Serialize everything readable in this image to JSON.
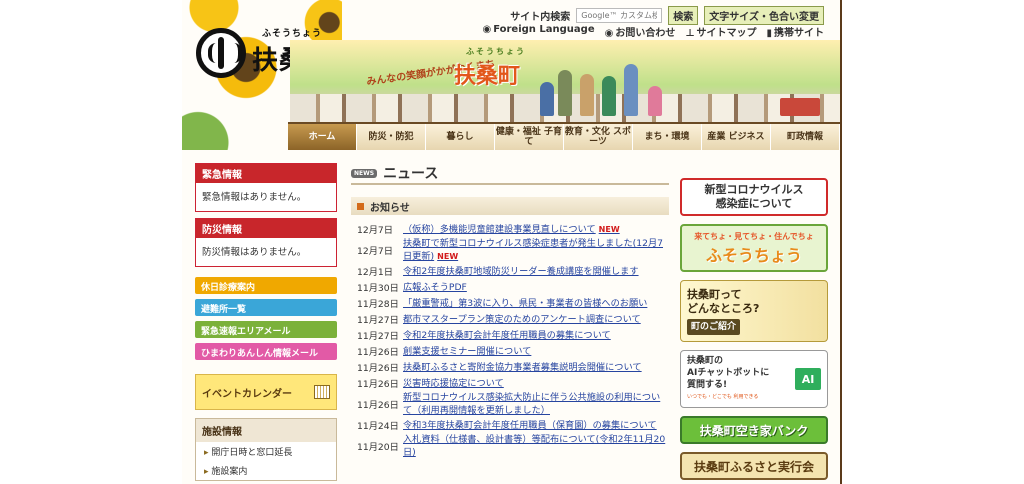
{
  "header": {
    "logo_ruby": "ふそうちょう",
    "logo_name": "扶桑町",
    "search_label": "サイト内検索",
    "search_placeholder": "Google™ カスタム検索",
    "search_button": "検索",
    "display_button": "文字サイズ・色合い変更",
    "util_links": [
      "Foreign Language",
      "お問い合わせ",
      "サイトマップ",
      "携帯サイト"
    ],
    "banner_tagline": "みんなの笑顔がかがやくまち",
    "banner_ruby": "ふそうちょう",
    "banner_title": "扶桑町"
  },
  "nav": [
    {
      "label": "ホーム",
      "active": true
    },
    {
      "label": "防災・防犯"
    },
    {
      "label": "暮らし"
    },
    {
      "label": "健康・福祉 子育て"
    },
    {
      "label": "教育・文化 スポーツ"
    },
    {
      "label": "まち・環境"
    },
    {
      "label": "産業 ビジネス"
    },
    {
      "label": "町政情報"
    }
  ],
  "left": {
    "emergency_title": "緊急情報",
    "emergency_text": "緊急情報はありません。",
    "disaster_title": "防災情報",
    "disaster_text": "防災情報はありません。",
    "buttons": [
      {
        "label": "休日診療案内",
        "color": "#f0a800"
      },
      {
        "label": "避難所一覧",
        "color": "#3aa6d8"
      },
      {
        "label": "緊急速報エリアメール",
        "color": "#7bb13a"
      },
      {
        "label": "ひまわりあんしん情報メール",
        "color": "#e25aa6"
      }
    ],
    "event_calendar": "イベントカレンダー",
    "facility_title": "施設情報",
    "facility_items": [
      "開庁日時と窓口延長",
      "施設案内"
    ]
  },
  "news": {
    "icon_text": "NEWS",
    "title": "ニュース",
    "notice_title": "お知らせ",
    "items": [
      {
        "date": "12月7日",
        "text": "（仮称）多機能児童館建設事業見直しについて",
        "new": "NEW"
      },
      {
        "date": "12月7日",
        "text": "扶桑町で新型コロナウイルス感染症患者が発生しました(12月7日更新)",
        "new": "NEW"
      },
      {
        "date": "12月1日",
        "text": "令和2年度扶桑町地域防災リーダー養成講座を開催します",
        "new": ""
      },
      {
        "date": "11月30日",
        "text": "広報ふそうPDF",
        "new": ""
      },
      {
        "date": "11月28日",
        "text": "「厳重警戒」第3波に入り、県民・事業者の皆様へのお願い",
        "new": ""
      },
      {
        "date": "11月27日",
        "text": "都市マスタープラン策定のためのアンケート調査について",
        "new": ""
      },
      {
        "date": "11月27日",
        "text": "令和2年度扶桑町会計年度任用職員の募集について",
        "new": ""
      },
      {
        "date": "11月26日",
        "text": "創業支援セミナー開催について",
        "new": ""
      },
      {
        "date": "11月26日",
        "text": "扶桑町ふるさと寄附金協力事業者募集説明会開催について",
        "new": ""
      },
      {
        "date": "11月26日",
        "text": "災害時応援協定について",
        "new": ""
      },
      {
        "date": "11月26日",
        "text": "新型コロナウイルス感染拡大防止に伴う公共施設の利用について（利用再開情報を更新しました）",
        "new": ""
      },
      {
        "date": "11月24日",
        "text": "令和3年度扶桑町会計年度任用職員（保育園）の募集について",
        "new": ""
      },
      {
        "date": "11月20日",
        "text": "入札資料（仕様書、設計書等）等配布について(令和2年11月20日)",
        "new": ""
      }
    ]
  },
  "right": {
    "covid_line1": "新型コロナウイルス",
    "covid_line2": "感染症について",
    "kitecho": "来てちょ・見てちょ・住んでちょ",
    "kitecho_name": "ふそうちょう",
    "fuso_q1": "扶桑町って",
    "fuso_q2": "どんなところ?",
    "fuso_link": "町のご紹介",
    "ai_line1": "扶桑町の",
    "ai_line2": "AIチャットボットに",
    "ai_line3": "質問する!",
    "ai_sub": "いつでも・どこでも 利用できる",
    "ai_badge": "AI",
    "akiya": "扶桑町空き家バンク",
    "furusato": "扶桑町ふるさと実行会"
  }
}
